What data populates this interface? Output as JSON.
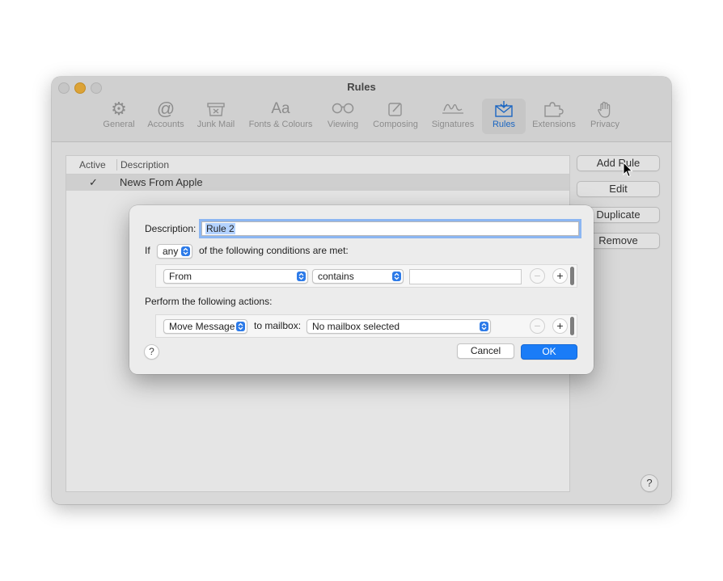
{
  "window": {
    "title": "Rules",
    "toolbar": [
      {
        "label": "General",
        "icon": "gear-icon"
      },
      {
        "label": "Accounts",
        "icon": "at-icon"
      },
      {
        "label": "Junk Mail",
        "icon": "junk-icon"
      },
      {
        "label": "Fonts & Colours",
        "icon": "fonts-icon"
      },
      {
        "label": "Viewing",
        "icon": "glasses-icon"
      },
      {
        "label": "Composing",
        "icon": "compose-icon"
      },
      {
        "label": "Signatures",
        "icon": "signature-icon"
      },
      {
        "label": "Rules",
        "icon": "rules-envelope-icon",
        "active": true
      },
      {
        "label": "Extensions",
        "icon": "puzzle-icon"
      },
      {
        "label": "Privacy",
        "icon": "hand-icon"
      }
    ]
  },
  "rules_list": {
    "col_active": "Active",
    "col_description": "Description",
    "rows": [
      {
        "active_mark": "✓",
        "description": "News From Apple"
      }
    ]
  },
  "side_buttons": {
    "add_rule": "Add Rule",
    "edit": "Edit",
    "duplicate": "Duplicate",
    "remove": "Remove"
  },
  "help_glyph": "?",
  "sheet": {
    "description_label": "Description:",
    "description_value": "Rule 2",
    "if_label": "If",
    "any_selector": "any",
    "conditions_suffix": "of the following conditions are met:",
    "condition": {
      "field": "From",
      "operator": "contains",
      "value": ""
    },
    "actions_label": "Perform the following actions:",
    "action": {
      "type": "Move Message",
      "to_mailbox_label": "to mailbox:",
      "mailbox": "No mailbox selected"
    },
    "minus_glyph": "−",
    "plus_glyph": "+",
    "cancel": "Cancel",
    "ok": "OK"
  },
  "colors": {
    "accent": "#1a7cf7",
    "active_tab": "#1a6fd8",
    "minimize": "#f5b43a"
  }
}
